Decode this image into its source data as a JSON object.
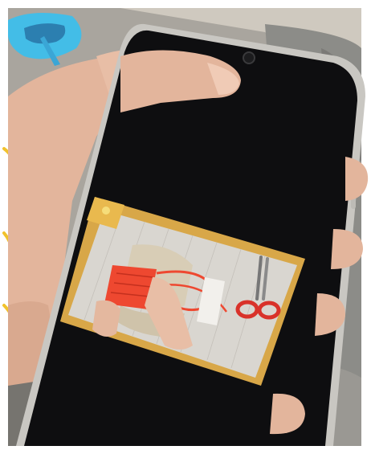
{
  "scene": {
    "description_label": "",
    "phone": {
      "screen_state": "video-playing",
      "video": {
        "logo_text": "",
        "content": "hands-weaving-red-yarn-with-scissors"
      }
    },
    "colors": {
      "background_white": "#ffffff",
      "room_backdrop": "#a9a59e",
      "couch_gray": "#8c8c88",
      "phone_frame": "#c9c7c2",
      "screen_black": "#0e0e10",
      "skin": "#e3b59c",
      "video_board": "#d9d6d0",
      "video_frame": "#d8a748",
      "yarn_red": "#ee4830",
      "scissors_handle": "#d9322a",
      "scissors_blade": "#777777",
      "toy_blue": "#43bde7",
      "accent_yellow": "#f1c22c"
    }
  }
}
